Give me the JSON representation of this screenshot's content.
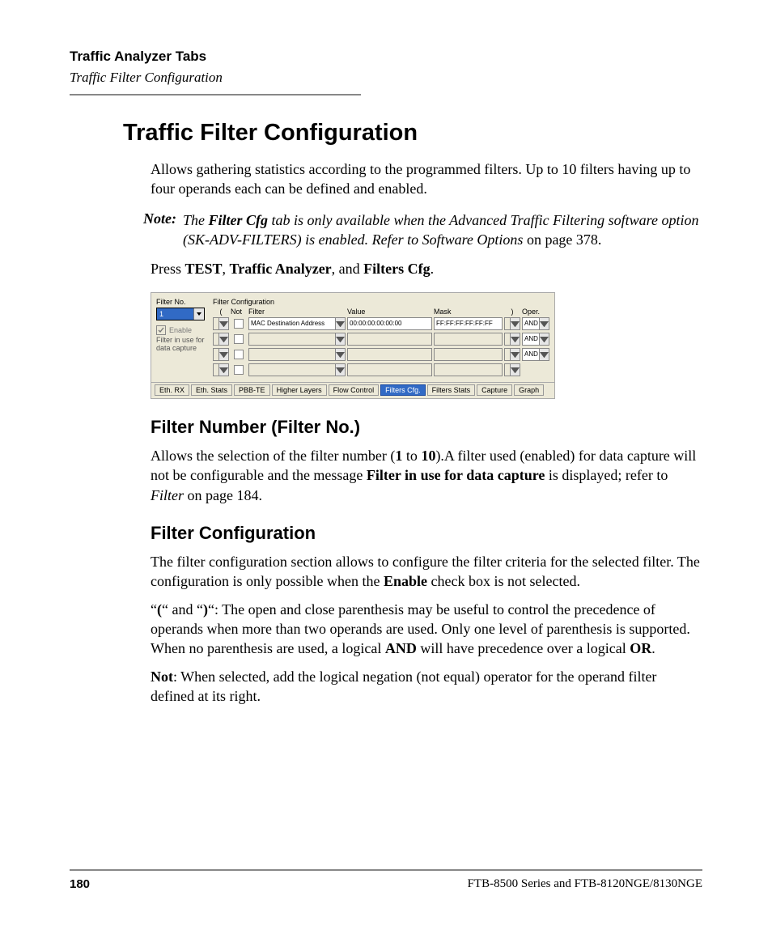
{
  "header": {
    "chapter": "Traffic Analyzer Tabs",
    "section": "Traffic Filter Configuration"
  },
  "title": "Traffic Filter Configuration",
  "intro": "Allows gathering statistics according to the programmed filters. Up to 10 filters having up to four operands each can be defined and enabled.",
  "note": {
    "label": "Note:",
    "p1a": "The ",
    "p1b": "Filter Cfg",
    "p1c": " tab is only available when the Advanced Traffic Filtering software option (SK-ADV-FILTERS) is enabled. Refer to Software Options",
    "p1d": " on page 378."
  },
  "press": {
    "a": "Press ",
    "b": "TEST",
    "c": ", ",
    "d": "Traffic Analyzer",
    "e": ", and ",
    "f": "Filters Cfg",
    "g": "."
  },
  "ui": {
    "filterno_label": "Filter No.",
    "filterno_value": "1",
    "enable_label": "Enable",
    "inuse_line1": "Filter in use for",
    "inuse_line2": "data capture",
    "cfg_title": "Filter Configuration",
    "headers": {
      "open": "(",
      "not": "Not",
      "filter": "Filter",
      "value": "Value",
      "mask": "Mask",
      "close": ")",
      "oper": "Oper."
    },
    "rows": [
      {
        "filter": "MAC Destination Address",
        "value": "00:00:00:00:00:00",
        "mask": "FF:FF:FF:FF:FF:FF",
        "oper": "AND"
      },
      {
        "filter": "",
        "value": "",
        "mask": "",
        "oper": "AND"
      },
      {
        "filter": "",
        "value": "",
        "mask": "",
        "oper": "AND"
      },
      {
        "filter": "",
        "value": "",
        "mask": "",
        "oper": ""
      }
    ],
    "tabs": [
      "Eth. RX",
      "Eth. Stats",
      "PBB-TE",
      "Higher Layers",
      "Flow Control",
      "Filters Cfg.",
      "Filters Stats",
      "Capture",
      "Graph"
    ],
    "active_tab_index": 5
  },
  "sec1": {
    "title": "Filter Number (Filter No.)",
    "p_a": "Allows the selection of the filter number (",
    "p_b": "1",
    "p_c": " to ",
    "p_d": "10",
    "p_e": ").A filter used (enabled) for data capture will not be configurable and the message ",
    "p_f": "Filter in use for data capture",
    "p_g": " is displayed; refer to ",
    "p_h": "Filter",
    "p_i": " on page 184."
  },
  "sec2": {
    "title": "Filter Configuration",
    "p1_a": "The filter configuration section allows to configure the filter criteria for the selected filter. The configuration is only possible when the ",
    "p1_b": "Enable",
    "p1_c": " check box is not selected.",
    "p2_a": "“",
    "p2_b": "(",
    "p2_c": "“ and “",
    "p2_d": ")",
    "p2_e": "“: The open and close parenthesis may be useful to control the precedence of operands when more than two operands are used. Only one level of parenthesis is supported. When no parenthesis are used, a logical ",
    "p2_f": "AND",
    "p2_g": " will have precedence over a logical ",
    "p2_h": "OR",
    "p2_i": ".",
    "p3_a": "Not",
    "p3_b": ": When selected, add the logical negation (not equal) operator for the operand filter defined at its right."
  },
  "footer": {
    "page": "180",
    "doc": "FTB-8500 Series and FTB-8120NGE/8130NGE"
  }
}
